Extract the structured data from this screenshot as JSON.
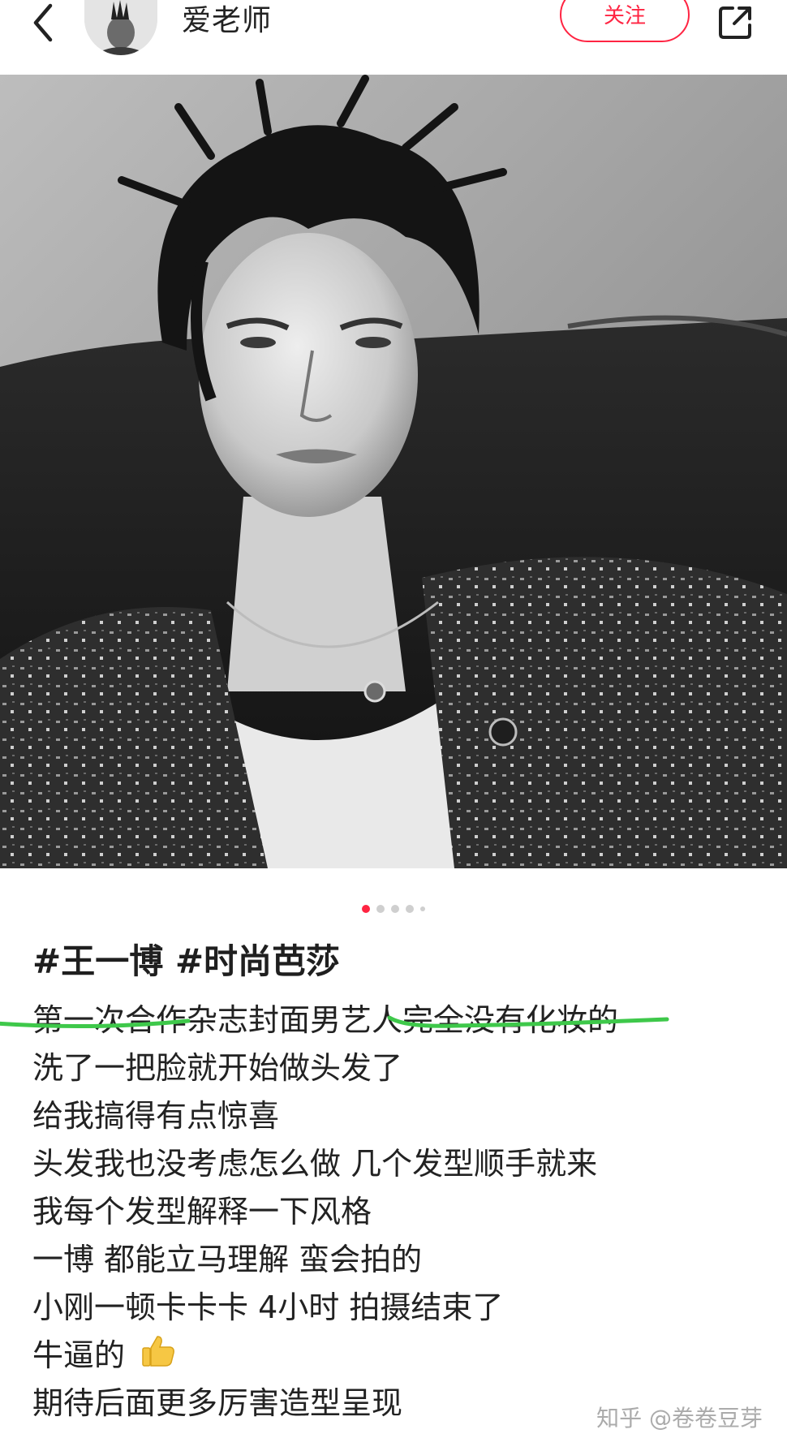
{
  "header": {
    "username": "爱老师",
    "follow_label": "关注"
  },
  "carousel": {
    "total": 5,
    "active_index": 0
  },
  "post": {
    "tags": "#王一博 #时尚芭莎",
    "lines": [
      "第一次合作杂志封面男艺人完全没有化妆的",
      "洗了一把脸就开始做头发了",
      "给我搞得有点惊喜",
      "头发我也没考虑怎么做 几个发型顺手就来",
      "我每个发型解释一下风格",
      "一博 都能立马理解 蛮会拍的",
      "小刚一顿卡卡卡 4小时 拍摄结束了",
      "牛逼的",
      "期待后面更多厉害造型呈现"
    ],
    "emoji": "thumbs-up"
  },
  "colors": {
    "accent": "#ff2442",
    "underline": "#3ec84a"
  },
  "watermark": "知乎 @卷卷豆芽"
}
